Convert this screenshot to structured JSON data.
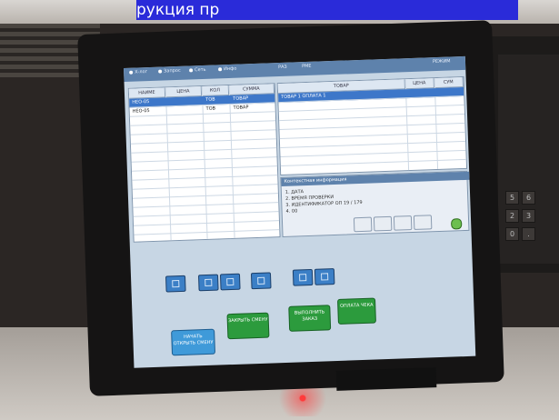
{
  "caption": "рукция пр",
  "screen": {
    "topbar": {
      "items": [
        "Х-лог",
        "Запрос",
        "Сеть",
        "Инфо",
        "РАЗ",
        "РМЕ"
      ],
      "right_status": "РЕЖИМ"
    },
    "left_table": {
      "columns": [
        "НАИМЕ",
        "ЦЕНА",
        "КОЛ",
        "СУММА"
      ],
      "rows": [
        [
          "НЕО-05",
          "",
          "ТОВ",
          "ТОВАР"
        ],
        [
          "НЕО-05",
          "",
          "ТОВ",
          "ТОВАР"
        ]
      ],
      "selected_row": 0
    },
    "right_table": {
      "columns": [
        "ТОВАР",
        "ЦЕНА",
        "СУМ"
      ],
      "rows": [
        [
          "ТОВАР 1 ОПЛАТА 1",
          "",
          ""
        ]
      ]
    },
    "info_panel": {
      "title": "Контекстная информация",
      "lines": [
        "1. ДАТА",
        "2. ВРЕМЯ ПРОВЕРКИ",
        "3. ИДЕНТИФИКАТОР ОП 19 / 179",
        "4. 00"
      ]
    },
    "action_buttons": [
      {
        "label": "НАЧАТЬ ОТКРЫТЬ СМЕНУ",
        "color": "blue"
      },
      {
        "label": "ЗАКРЫТЬ СМЕНУ",
        "color": "green"
      },
      {
        "label": "ВЫПОЛНИТЬ ЗАКАЗ",
        "color": "green"
      },
      {
        "label": "ОПЛАТА ЧЕКА",
        "color": "green"
      }
    ]
  },
  "keypad": {
    "keys": [
      "5",
      "6",
      "2",
      "3",
      "0",
      "."
    ]
  },
  "colors": {
    "screen_bg": "#c7d6e4",
    "topbar": "#5e82ac",
    "selection": "#3d77c9",
    "blue_button": "#3f9ad9",
    "green_button": "#2c9b3d"
  }
}
